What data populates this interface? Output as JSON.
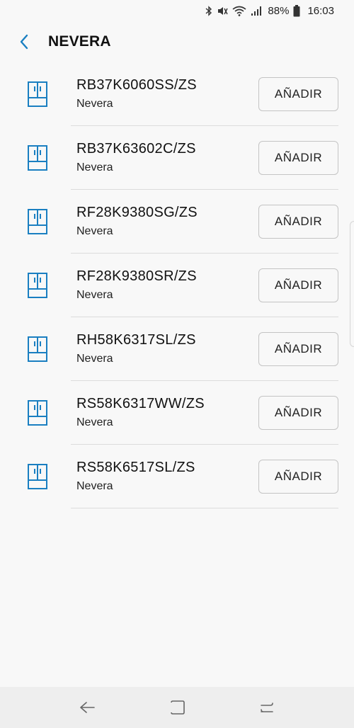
{
  "status_bar": {
    "battery_percent": "88%",
    "time": "16:03",
    "icons": [
      "bluetooth-icon",
      "mute-icon",
      "wifi-icon",
      "signal-icon",
      "battery-icon"
    ]
  },
  "header": {
    "title": "NEVERA",
    "back_icon": "chevron-left-icon"
  },
  "colors": {
    "accent": "#1a7fc1",
    "background": "#f8f8f8",
    "divider": "#dcdcdc",
    "nav_bar": "#eeeeee"
  },
  "devices": [
    {
      "model": "RB37K6060SS/ZS",
      "type": "Nevera",
      "action": "AÑADIR",
      "icon": "fridge-icon"
    },
    {
      "model": "RB37K63602C/ZS",
      "type": "Nevera",
      "action": "AÑADIR",
      "icon": "fridge-icon"
    },
    {
      "model": "RF28K9380SG/ZS",
      "type": "Nevera",
      "action": "AÑADIR",
      "icon": "fridge-icon"
    },
    {
      "model": "RF28K9380SR/ZS",
      "type": "Nevera",
      "action": "AÑADIR",
      "icon": "fridge-icon"
    },
    {
      "model": "RH58K6317SL/ZS",
      "type": "Nevera",
      "action": "AÑADIR",
      "icon": "fridge-icon"
    },
    {
      "model": "RS58K6317WW/ZS",
      "type": "Nevera",
      "action": "AÑADIR",
      "icon": "fridge-icon"
    },
    {
      "model": "RS58K6517SL/ZS",
      "type": "Nevera",
      "action": "AÑADIR",
      "icon": "fridge-icon"
    }
  ],
  "nav_bar": {
    "buttons": [
      "back-nav-icon",
      "home-nav-icon",
      "recents-nav-icon"
    ]
  }
}
